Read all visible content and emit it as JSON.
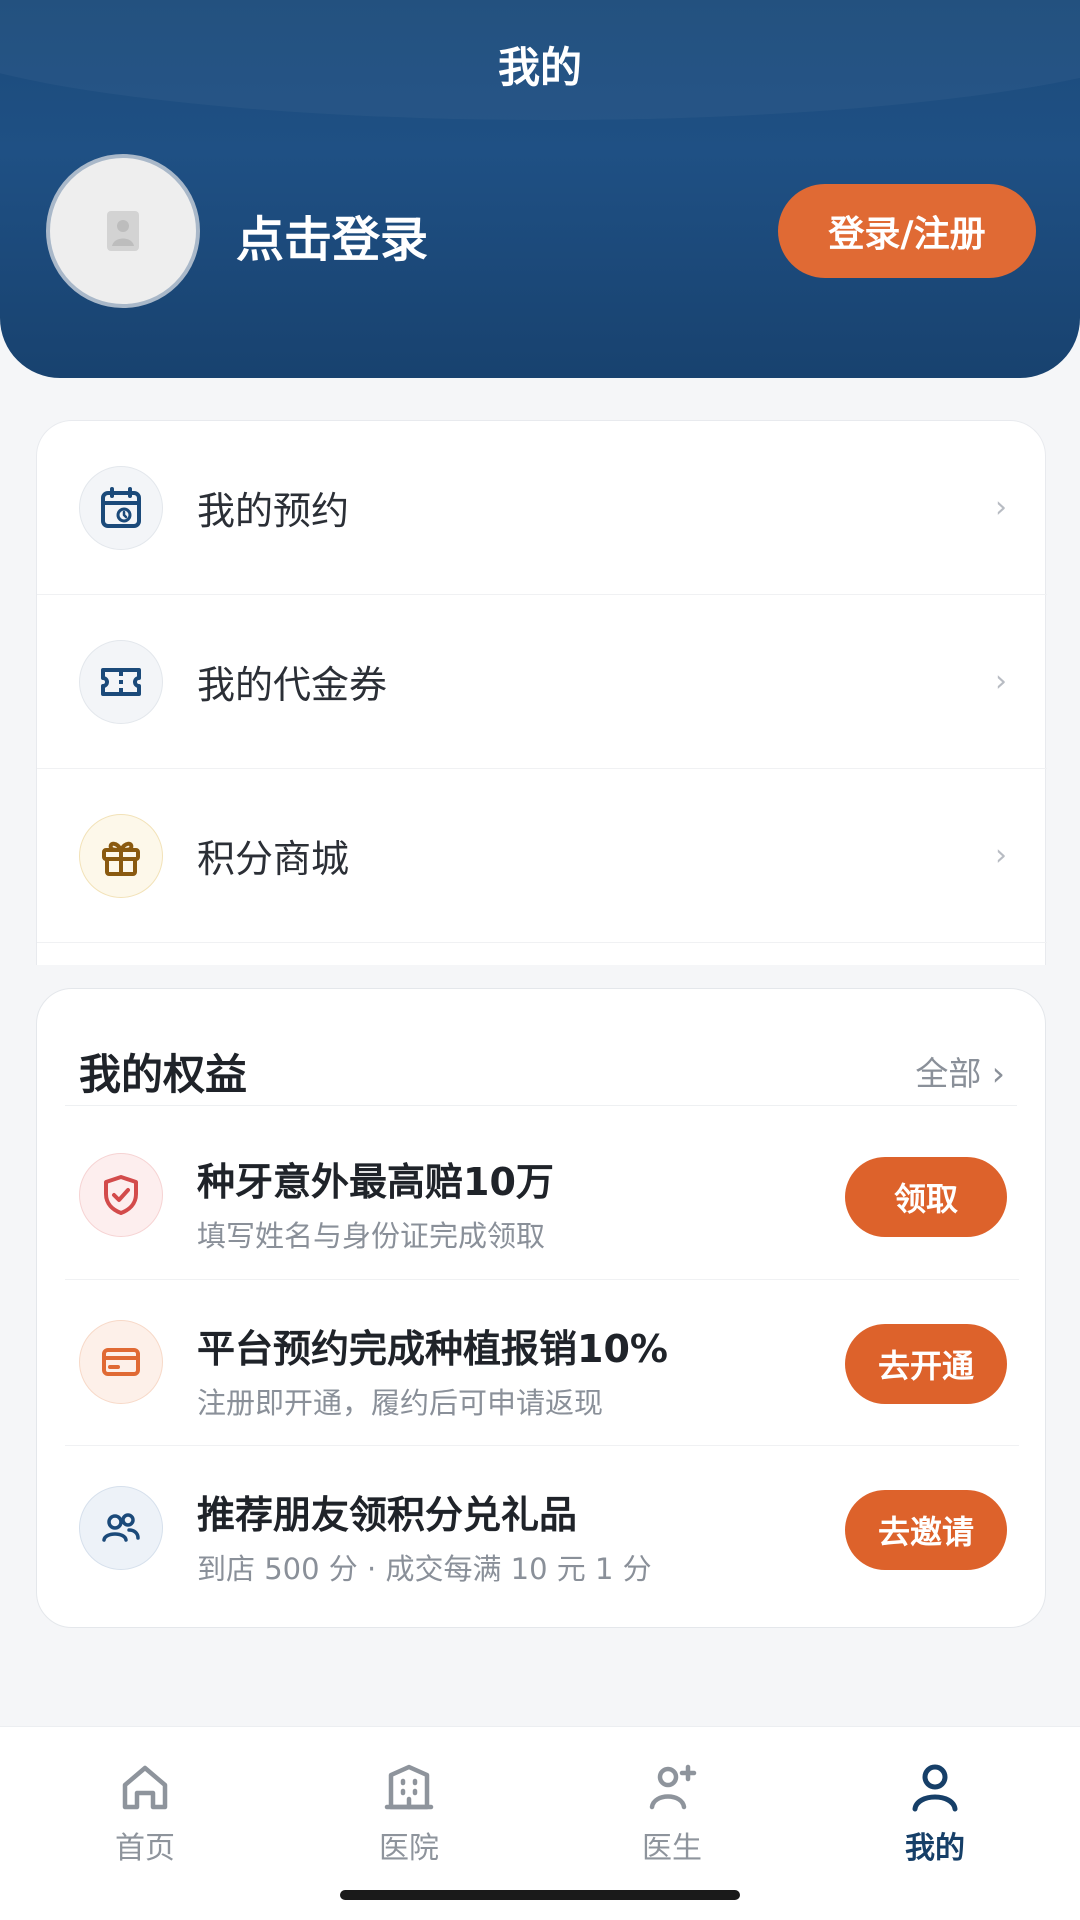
{
  "header": {
    "title": "我的",
    "login_prompt": "点击登录",
    "login_button": "登录/注册"
  },
  "menu": {
    "items": [
      {
        "label": "我的预约",
        "icon": "calendar-icon",
        "chevron": "›"
      },
      {
        "label": "我的代金券",
        "icon": "ticket-icon",
        "chevron": "›"
      },
      {
        "label": "积分商城",
        "icon": "gift-icon",
        "chevron": "›"
      }
    ]
  },
  "benefits": {
    "title": "我的权益",
    "all_label": "全部 ›",
    "items": [
      {
        "title": "种牙意外最高赔10万",
        "subtitle": "填写姓名与身份证完成领取",
        "button": "领取",
        "icon": "shield-check-icon"
      },
      {
        "title": "平台预约完成种植报销10%",
        "subtitle": "注册即开通，履约后可申请返现",
        "button": "去开通",
        "icon": "card-icon"
      },
      {
        "title": "推荐朋友领积分兑礼品",
        "subtitle": "到店 500 分 · 成交每满 10 元 1 分",
        "button": "去邀请",
        "icon": "people-icon"
      }
    ]
  },
  "tabbar": {
    "tabs": [
      {
        "label": "首页",
        "icon": "home-icon"
      },
      {
        "label": "医院",
        "icon": "hospital-icon"
      },
      {
        "label": "医生",
        "icon": "doctor-icon"
      },
      {
        "label": "我的",
        "icon": "user-icon",
        "active": true
      }
    ]
  },
  "colors": {
    "header_bg": "#1f5084",
    "accent_orange": "#dd622b",
    "active_tab": "#163f68"
  }
}
